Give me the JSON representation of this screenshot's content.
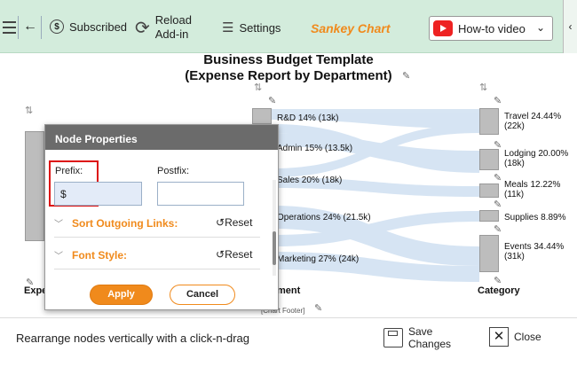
{
  "toolbar": {
    "subscribed": "Subscribed",
    "reload_line1": "Reload",
    "reload_line2": "Add-in",
    "settings": "Settings",
    "brand": "Sankey Chart",
    "howto": "How-to video",
    "brand_color": "#f08a1c",
    "bg_color": "#d3ecdc"
  },
  "chart": {
    "title_line1": "Business Budget Template",
    "title_line2": "(Expense Report by Department)",
    "footer": "[Chart Footer]",
    "axis_left": "Expe",
    "axis_middle": "ment",
    "axis_right": "Category",
    "mid_nodes": [
      {
        "label": "R&D 14% (13k)"
      },
      {
        "label": "Admin 15% (13.5k)"
      },
      {
        "label": "Sales 20% (18k)"
      },
      {
        "label": "Operations 24% (21.5k)"
      },
      {
        "label": "Marketing 27% (24k)"
      }
    ],
    "right_nodes": [
      {
        "line1": "Travel 24.44%",
        "line2": "(22k)"
      },
      {
        "line1": "Lodging 20.00%",
        "line2": "(18k)"
      },
      {
        "line1": "Meals 12.22%",
        "line2": "(11k)"
      },
      {
        "line1": "Supplies 8.89%",
        "line2": ""
      },
      {
        "line1": "Events 34.44%",
        "line2": "(31k)"
      }
    ]
  },
  "dialog": {
    "title": "Node Properties",
    "prefix_label": "Prefix:",
    "prefix_value": "$",
    "postfix_label": "Postfix:",
    "postfix_value": "",
    "sort_label": "Sort Outgoing Links:",
    "font_label": "Font Style:",
    "reset_label": "Reset",
    "apply_label": "Apply",
    "cancel_label": "Cancel",
    "accent_color": "#f08a1c"
  },
  "bottom": {
    "hint": "Rearrange nodes vertically with a click-n-drag",
    "save_line1": "Save",
    "save_line2": "Changes",
    "close": "Close"
  }
}
